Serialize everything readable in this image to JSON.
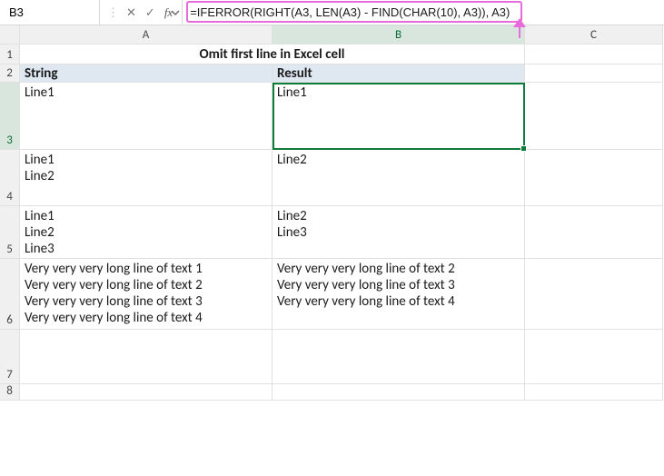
{
  "formula_bar": {
    "cell_ref": "B3",
    "formula": "=IFERROR(RIGHT(A3, LEN(A3) - FIND(CHAR(10), A3)), A3)",
    "cancel_tip": "✕",
    "enter_tip": "✓",
    "fx": "fx"
  },
  "columns": [
    "A",
    "B",
    "C"
  ],
  "active_col": "B",
  "active_row": "3",
  "rows": [
    "1",
    "2",
    "3",
    "4",
    "5",
    "6",
    "7",
    "8"
  ],
  "title": "Omit first line in Excel cell",
  "headers": {
    "a": "String",
    "b": "Result"
  },
  "data": [
    {
      "a": "Line1",
      "b": "Line1"
    },
    {
      "a": "Line1\nLine2",
      "b": "Line2"
    },
    {
      "a": "Line1\nLine2\nLine3",
      "b": "Line2\nLine3"
    },
    {
      "a": "Very very very long line of text 1\nVery very very long line of text 2\nVery very very long line of text 3\nVery very very long line of text 4",
      "b": "Very very very long line of text 2\nVery very very long line of text 3\nVery very very long line of text 4"
    }
  ]
}
